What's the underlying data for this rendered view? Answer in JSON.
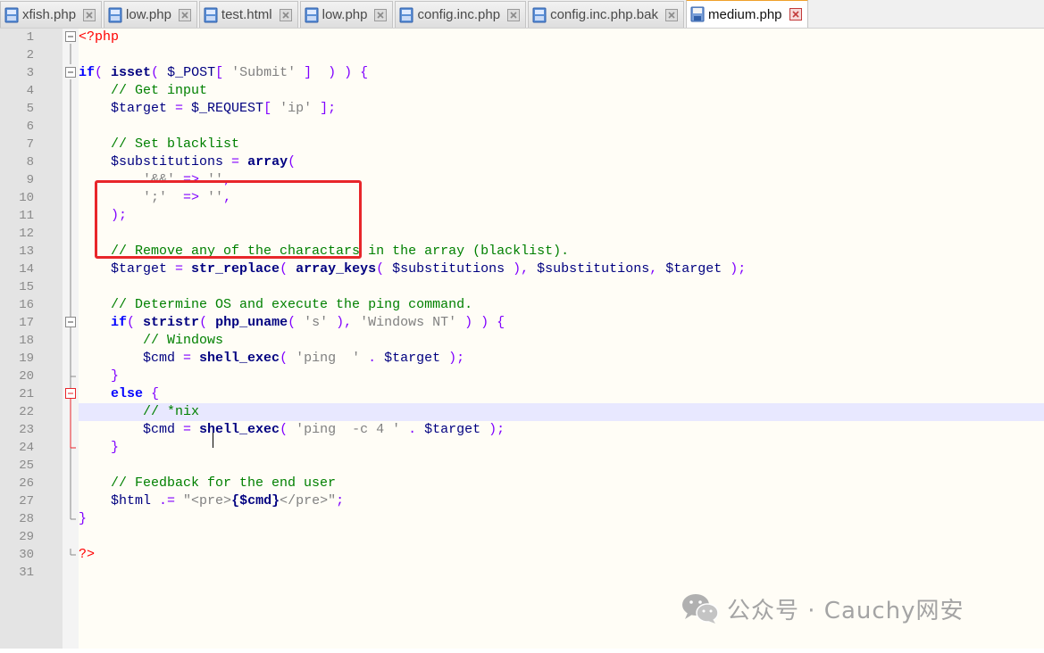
{
  "tabs": [
    {
      "label": "xfish.php",
      "active": false
    },
    {
      "label": "low.php",
      "active": false
    },
    {
      "label": "test.html",
      "active": false
    },
    {
      "label": "low.php",
      "active": false
    },
    {
      "label": "config.inc.php",
      "active": false
    },
    {
      "label": "config.inc.php.bak",
      "active": false
    },
    {
      "label": "medium.php",
      "active": true
    }
  ],
  "line_numbers": [
    "1",
    "2",
    "3",
    "4",
    "5",
    "6",
    "7",
    "8",
    "9",
    "10",
    "11",
    "12",
    "13",
    "14",
    "15",
    "16",
    "17",
    "18",
    "19",
    "20",
    "21",
    "22",
    "23",
    "24",
    "25",
    "26",
    "27",
    "28",
    "29",
    "30",
    "31"
  ],
  "code": {
    "l1": {
      "t0": "<?php"
    },
    "l3": {
      "t0": "if",
      "t1": "( ",
      "t2": "isset",
      "t3": "( ",
      "t4": "$_POST",
      "t5": "[ ",
      "t6": "'Submit'",
      "t7": " ]  ) ) {"
    },
    "l4": {
      "t0": "// Get input"
    },
    "l5": {
      "t0": "$target",
      "t1": " = ",
      "t2": "$_REQUEST",
      "t3": "[ ",
      "t4": "'ip'",
      "t5": " ];"
    },
    "l7": {
      "t0": "// Set blacklist"
    },
    "l8": {
      "t0": "$substitutions",
      "t1": " = ",
      "t2": "array",
      "t3": "("
    },
    "l9": {
      "t0": "'&&'",
      "t1": " => ",
      "t2": "''",
      "t3": ","
    },
    "l10": {
      "t0": "';'",
      "t1": "  => ",
      "t2": "''",
      "t3": ","
    },
    "l11": {
      "t0": ");"
    },
    "l13": {
      "t0": "// Remove any of the charactars in the array (blacklist)."
    },
    "l14": {
      "t0": "$target",
      "t1": " = ",
      "t2": "str_replace",
      "t3": "( ",
      "t4": "array_keys",
      "t5": "( ",
      "t6": "$substitutions",
      "t7": " ), ",
      "t8": "$substitutions",
      "t9": ", ",
      "t10": "$target",
      "t11": " );"
    },
    "l16": {
      "t0": "// Determine OS and execute the ping command."
    },
    "l17": {
      "t0": "if",
      "t1": "( ",
      "t2": "stristr",
      "t3": "( ",
      "t4": "php_uname",
      "t5": "( ",
      "t6": "'s'",
      "t7": " ), ",
      "t8": "'Windows NT'",
      "t9": " ) ) {"
    },
    "l18": {
      "t0": "// Windows"
    },
    "l19": {
      "t0": "$cmd",
      "t1": " = ",
      "t2": "shell_exec",
      "t3": "( ",
      "t4": "'ping  '",
      "t5": " . ",
      "t6": "$target",
      "t7": " );"
    },
    "l20": {
      "t0": "}"
    },
    "l21": {
      "t0": "else",
      "t1": " {"
    },
    "l22": {
      "t0": "// *nix"
    },
    "l23": {
      "t0": "$cmd",
      "t1": " = ",
      "t2": "shell_exec",
      "t3": "( ",
      "t4": "'ping  -c 4 '",
      "t5": " . ",
      "t6": "$target",
      "t7": " );"
    },
    "l24": {
      "t0": "}"
    },
    "l26": {
      "t0": "// Feedback for the end user"
    },
    "l27": {
      "t0": "$html",
      "t1": " .= ",
      "t2": "\"<pre>",
      "t3": "{$cmd}",
      "t4": "</pre>\"",
      "t5": ";"
    },
    "l28": {
      "t0": "}"
    },
    "l30": {
      "t0": "?>"
    }
  },
  "watermark": {
    "text": "公众号 · Cauchy网安",
    "icon": "wechat-icon"
  },
  "colors": {
    "highlight_box": "#e8262b",
    "keyword": "#0000ff",
    "comment": "#008000",
    "string": "#808080",
    "php_tag": "#ff0000",
    "operator": "#8000ff"
  }
}
